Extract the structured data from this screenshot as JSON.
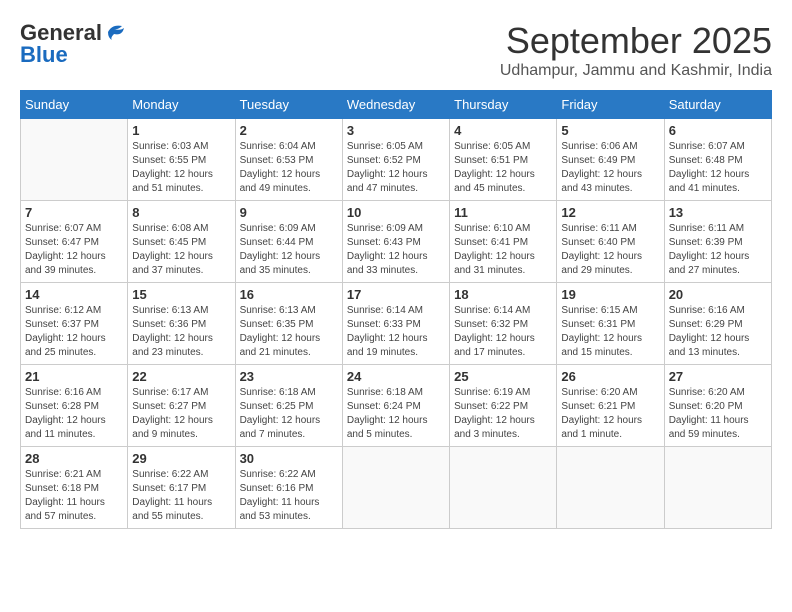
{
  "logo": {
    "general": "General",
    "blue": "Blue"
  },
  "title": "September 2025",
  "subtitle": "Udhampur, Jammu and Kashmir, India",
  "weekdays": [
    "Sunday",
    "Monday",
    "Tuesday",
    "Wednesday",
    "Thursday",
    "Friday",
    "Saturday"
  ],
  "weeks": [
    [
      {
        "day": "",
        "info": ""
      },
      {
        "day": "1",
        "info": "Sunrise: 6:03 AM\nSunset: 6:55 PM\nDaylight: 12 hours\nand 51 minutes."
      },
      {
        "day": "2",
        "info": "Sunrise: 6:04 AM\nSunset: 6:53 PM\nDaylight: 12 hours\nand 49 minutes."
      },
      {
        "day": "3",
        "info": "Sunrise: 6:05 AM\nSunset: 6:52 PM\nDaylight: 12 hours\nand 47 minutes."
      },
      {
        "day": "4",
        "info": "Sunrise: 6:05 AM\nSunset: 6:51 PM\nDaylight: 12 hours\nand 45 minutes."
      },
      {
        "day": "5",
        "info": "Sunrise: 6:06 AM\nSunset: 6:49 PM\nDaylight: 12 hours\nand 43 minutes."
      },
      {
        "day": "6",
        "info": "Sunrise: 6:07 AM\nSunset: 6:48 PM\nDaylight: 12 hours\nand 41 minutes."
      }
    ],
    [
      {
        "day": "7",
        "info": "Sunrise: 6:07 AM\nSunset: 6:47 PM\nDaylight: 12 hours\nand 39 minutes."
      },
      {
        "day": "8",
        "info": "Sunrise: 6:08 AM\nSunset: 6:45 PM\nDaylight: 12 hours\nand 37 minutes."
      },
      {
        "day": "9",
        "info": "Sunrise: 6:09 AM\nSunset: 6:44 PM\nDaylight: 12 hours\nand 35 minutes."
      },
      {
        "day": "10",
        "info": "Sunrise: 6:09 AM\nSunset: 6:43 PM\nDaylight: 12 hours\nand 33 minutes."
      },
      {
        "day": "11",
        "info": "Sunrise: 6:10 AM\nSunset: 6:41 PM\nDaylight: 12 hours\nand 31 minutes."
      },
      {
        "day": "12",
        "info": "Sunrise: 6:11 AM\nSunset: 6:40 PM\nDaylight: 12 hours\nand 29 minutes."
      },
      {
        "day": "13",
        "info": "Sunrise: 6:11 AM\nSunset: 6:39 PM\nDaylight: 12 hours\nand 27 minutes."
      }
    ],
    [
      {
        "day": "14",
        "info": "Sunrise: 6:12 AM\nSunset: 6:37 PM\nDaylight: 12 hours\nand 25 minutes."
      },
      {
        "day": "15",
        "info": "Sunrise: 6:13 AM\nSunset: 6:36 PM\nDaylight: 12 hours\nand 23 minutes."
      },
      {
        "day": "16",
        "info": "Sunrise: 6:13 AM\nSunset: 6:35 PM\nDaylight: 12 hours\nand 21 minutes."
      },
      {
        "day": "17",
        "info": "Sunrise: 6:14 AM\nSunset: 6:33 PM\nDaylight: 12 hours\nand 19 minutes."
      },
      {
        "day": "18",
        "info": "Sunrise: 6:14 AM\nSunset: 6:32 PM\nDaylight: 12 hours\nand 17 minutes."
      },
      {
        "day": "19",
        "info": "Sunrise: 6:15 AM\nSunset: 6:31 PM\nDaylight: 12 hours\nand 15 minutes."
      },
      {
        "day": "20",
        "info": "Sunrise: 6:16 AM\nSunset: 6:29 PM\nDaylight: 12 hours\nand 13 minutes."
      }
    ],
    [
      {
        "day": "21",
        "info": "Sunrise: 6:16 AM\nSunset: 6:28 PM\nDaylight: 12 hours\nand 11 minutes."
      },
      {
        "day": "22",
        "info": "Sunrise: 6:17 AM\nSunset: 6:27 PM\nDaylight: 12 hours\nand 9 minutes."
      },
      {
        "day": "23",
        "info": "Sunrise: 6:18 AM\nSunset: 6:25 PM\nDaylight: 12 hours\nand 7 minutes."
      },
      {
        "day": "24",
        "info": "Sunrise: 6:18 AM\nSunset: 6:24 PM\nDaylight: 12 hours\nand 5 minutes."
      },
      {
        "day": "25",
        "info": "Sunrise: 6:19 AM\nSunset: 6:22 PM\nDaylight: 12 hours\nand 3 minutes."
      },
      {
        "day": "26",
        "info": "Sunrise: 6:20 AM\nSunset: 6:21 PM\nDaylight: 12 hours\nand 1 minute."
      },
      {
        "day": "27",
        "info": "Sunrise: 6:20 AM\nSunset: 6:20 PM\nDaylight: 11 hours\nand 59 minutes."
      }
    ],
    [
      {
        "day": "28",
        "info": "Sunrise: 6:21 AM\nSunset: 6:18 PM\nDaylight: 11 hours\nand 57 minutes."
      },
      {
        "day": "29",
        "info": "Sunrise: 6:22 AM\nSunset: 6:17 PM\nDaylight: 11 hours\nand 55 minutes."
      },
      {
        "day": "30",
        "info": "Sunrise: 6:22 AM\nSunset: 6:16 PM\nDaylight: 11 hours\nand 53 minutes."
      },
      {
        "day": "",
        "info": ""
      },
      {
        "day": "",
        "info": ""
      },
      {
        "day": "",
        "info": ""
      },
      {
        "day": "",
        "info": ""
      }
    ]
  ]
}
